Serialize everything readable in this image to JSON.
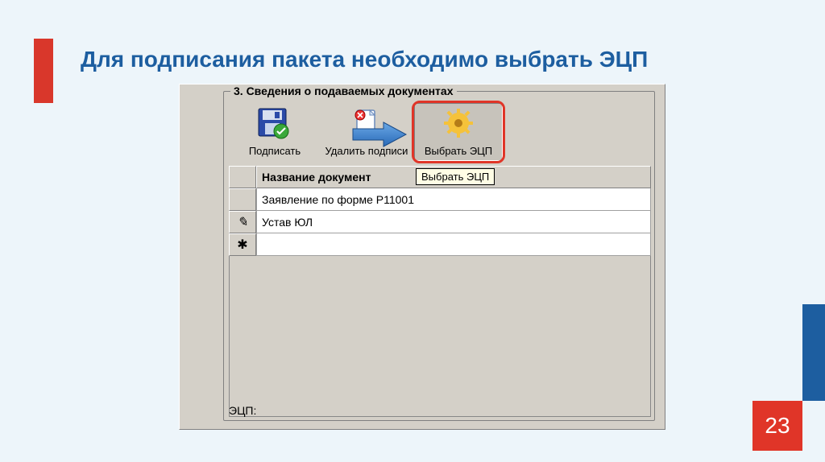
{
  "slide": {
    "title": "Для подписания пакета необходимо выбрать ЭЦП",
    "page_number": "23"
  },
  "groupbox": {
    "title": "3. Сведения о подаваемых документах"
  },
  "toolbar": {
    "sign_label": "Подписать",
    "delete_label": "Удалить подписи",
    "choose_label": "Выбрать ЭЦП"
  },
  "tooltip": "Выбрать ЭЦП",
  "grid": {
    "header": "Название документ",
    "rows": [
      {
        "selcol": "",
        "name": "Заявление по форме Р11001"
      },
      {
        "selcol": "✎",
        "name": "Устав ЮЛ"
      },
      {
        "selcol": "✱",
        "name": ""
      }
    ]
  },
  "bottom_label": "ЭЦП:"
}
